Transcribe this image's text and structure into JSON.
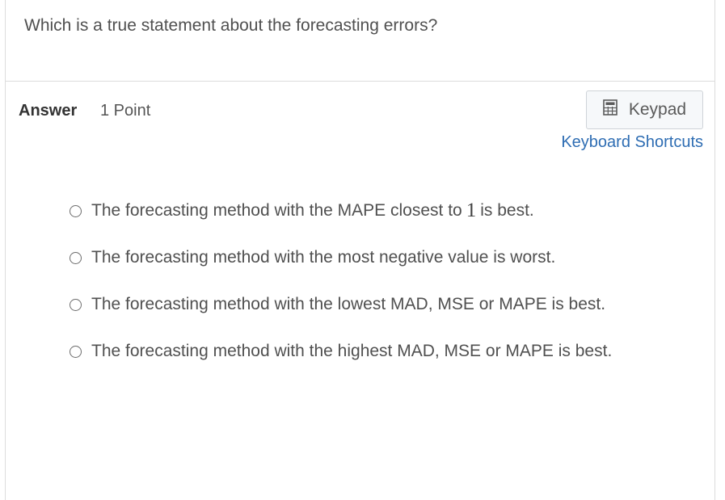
{
  "question": "Which is a true statement about the forecasting errors?",
  "answer": {
    "label": "Answer",
    "points": "1 Point"
  },
  "toolbar": {
    "keypad_label": "Keypad",
    "keypad_icon": "calculator-icon",
    "shortcuts_label": "Keyboard Shortcuts"
  },
  "options": [
    {
      "before": "The forecasting method with the MAPE closest to",
      "math": "1",
      "after": "is best."
    },
    {
      "text": "The forecasting method with the most negative value is worst."
    },
    {
      "text": "The forecasting method with the lowest MAD, MSE or MAPE is best."
    },
    {
      "text": "The forecasting method with the highest MAD, MSE or MAPE is best."
    }
  ],
  "colors": {
    "link": "#2e6db3",
    "button_bg": "#f6f8fa",
    "border": "#dcdcdc"
  }
}
